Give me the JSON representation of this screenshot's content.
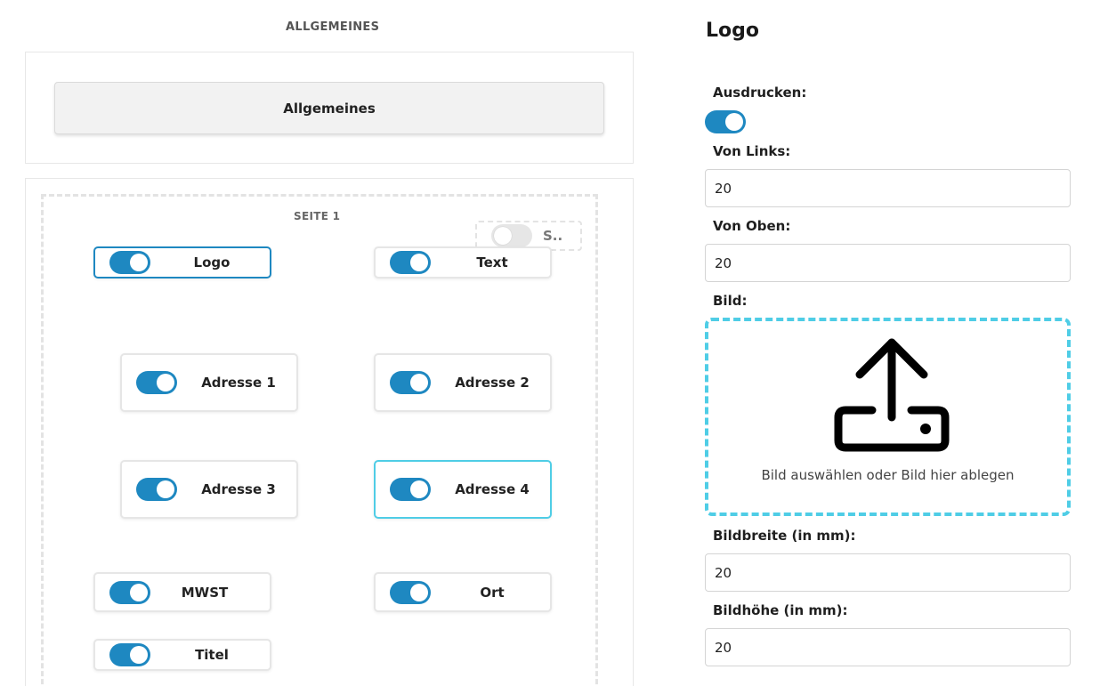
{
  "left": {
    "section_title": "ALLGEMEINES",
    "general_button": "Allgemeines",
    "page_label": "SEITE 1",
    "slot_label": "S..",
    "fields": [
      {
        "label": "Logo",
        "enabled": true,
        "selected": true
      },
      {
        "label": "Text",
        "enabled": true,
        "selected": false
      },
      {
        "label": "Adresse 1",
        "enabled": true,
        "selected": false
      },
      {
        "label": "Adresse 2",
        "enabled": true,
        "selected": false
      },
      {
        "label": "Adresse 3",
        "enabled": true,
        "selected": false
      },
      {
        "label": "Adresse 4",
        "enabled": true,
        "selected": false
      },
      {
        "label": "MWST",
        "enabled": true,
        "selected": false
      },
      {
        "label": "Ort",
        "enabled": true,
        "selected": false
      },
      {
        "label": "Titel",
        "enabled": true,
        "selected": false
      }
    ]
  },
  "right": {
    "title": "Logo",
    "print_label": "Ausdrucken:",
    "print_enabled": true,
    "from_left_label": "Von Links:",
    "from_left_value": "20",
    "from_top_label": "Von Oben:",
    "from_top_value": "20",
    "image_label": "Bild:",
    "dropzone_text": "Bild auswählen oder Bild hier ablegen",
    "width_label": "Bildbreite (in mm):",
    "width_value": "20",
    "height_label": "Bildhöhe (in mm):",
    "height_value": "20"
  },
  "colors": {
    "toggle_on": "#1e88c1",
    "selected_border": "#1e88c1",
    "hover_border": "#4fcde6",
    "dropzone_border": "#4fcde6"
  }
}
